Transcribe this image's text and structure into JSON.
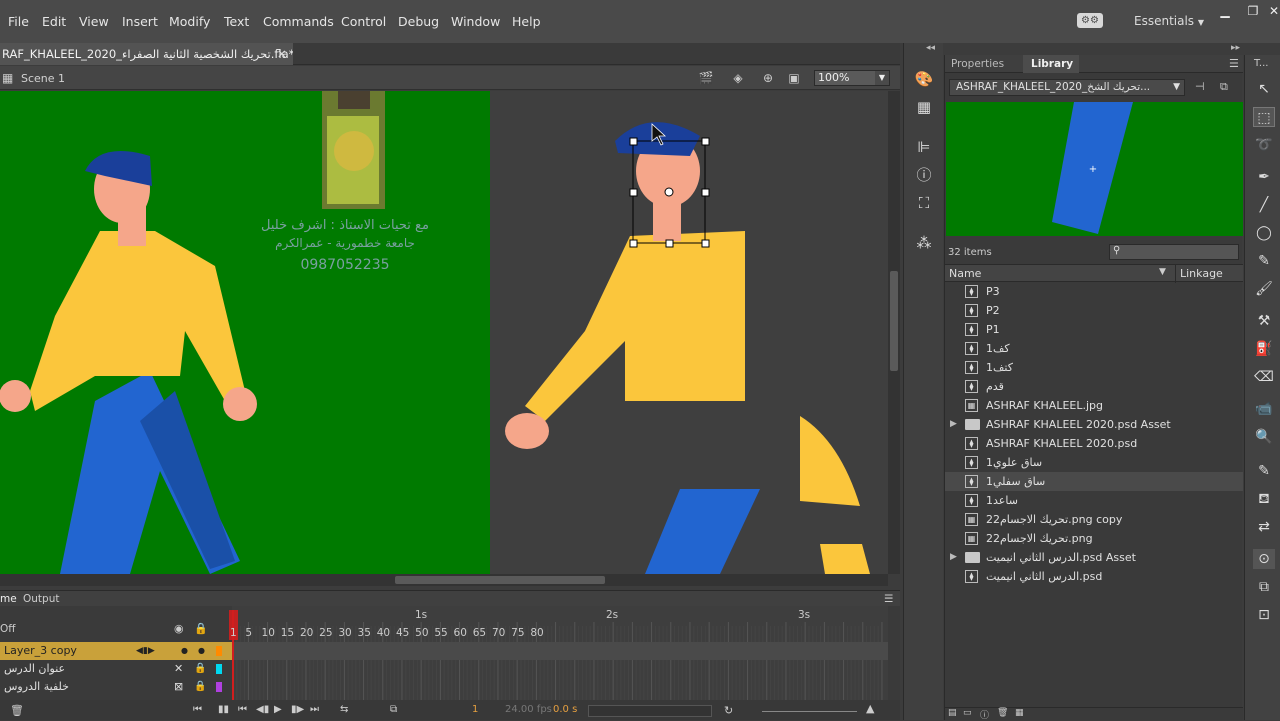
{
  "menu": [
    "File",
    "Edit",
    "View",
    "Insert",
    "Modify",
    "Text",
    "Commands",
    "Control",
    "Debug",
    "Window",
    "Help"
  ],
  "workspace": "Essentials",
  "document_tab": "RAF_KHALEEL_2020_تحريك الشخصية الثانية الصفراء.fla*",
  "scene": "Scene 1",
  "zoom": "100%",
  "stage_text": {
    "line1": "مع تحيات  الاستاذ : اشرف خليل",
    "line2": "جامعة خطمورية - عمرالكرم",
    "line3": "0987052235"
  },
  "colors": {
    "stage_green": "#007a00",
    "skin": "#f5a68a",
    "shirt": "#fbc63c",
    "pants": "#2265d0",
    "hair": "#1a3f9a",
    "timeline_highlight": "#c9a13a",
    "playhead": "#d11e1e"
  },
  "timeline": {
    "tabs": [
      "me",
      "Output"
    ],
    "onion": "Off",
    "ruler_seconds": [
      "1s",
      "2s",
      "3s"
    ],
    "ruler_frames": [
      "1",
      "5",
      "10",
      "15",
      "20",
      "25",
      "30",
      "35",
      "40",
      "45",
      "50",
      "55",
      "60",
      "65",
      "70",
      "75",
      "80"
    ],
    "layers": [
      {
        "name": "Layer_3 copy",
        "selected": true,
        "color": "#ff8a00"
      },
      {
        "name": "عنوان الدرس",
        "selected": false,
        "color": "#00d8f0"
      },
      {
        "name": "خلفية الدروس",
        "selected": false,
        "color": "#b040e0"
      }
    ],
    "current_frame": "1",
    "fps": "24.00 fps",
    "time": "0.0 s"
  },
  "library": {
    "tabs": [
      "Properties",
      "Library"
    ],
    "document": "ASHRAF_KHALEEL_2020_تحريك الشخ...",
    "count": "32 items",
    "columns": {
      "name": "Name",
      "linkage": "Linkage"
    },
    "items": [
      {
        "name": "P3",
        "kind": "symbol"
      },
      {
        "name": "P2",
        "kind": "symbol"
      },
      {
        "name": "P1",
        "kind": "symbol"
      },
      {
        "name": "كف1",
        "kind": "symbol"
      },
      {
        "name": "كتف1",
        "kind": "symbol"
      },
      {
        "name": "قدم",
        "kind": "symbol"
      },
      {
        "name": "ASHRAF KHALEEL.jpg",
        "kind": "bitmap"
      },
      {
        "name": "ASHRAF KHALEEL 2020.psd Asset",
        "kind": "folder"
      },
      {
        "name": "ASHRAF KHALEEL 2020.psd",
        "kind": "symbol"
      },
      {
        "name": "ساق علوي1",
        "kind": "symbol"
      },
      {
        "name": "ساق سفلي1",
        "kind": "symbol",
        "selected": true
      },
      {
        "name": "ساعد1",
        "kind": "symbol"
      },
      {
        "name": "تحريك الاجسام22.png copy",
        "kind": "bitmap"
      },
      {
        "name": "تحريك الاجسام22.png",
        "kind": "bitmap"
      },
      {
        "name": "الدرس الثاني انيميت.psd Asset",
        "kind": "folder"
      },
      {
        "name": "الدرس الثاني انيميت.psd",
        "kind": "symbol"
      }
    ]
  }
}
